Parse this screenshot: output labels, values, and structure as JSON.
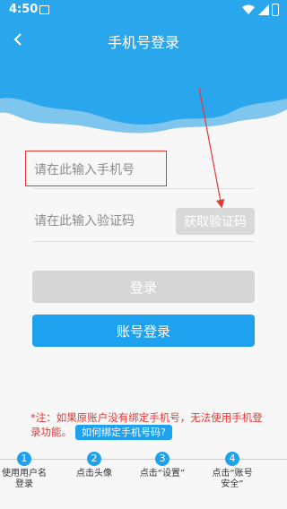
{
  "status_bar": {
    "time": "4:50"
  },
  "toolbar": {
    "title": "手机号登录",
    "back_icon": "back-arrow-icon"
  },
  "form": {
    "phone_placeholder": "请在此输入手机号",
    "code_placeholder": "请在此输入验证码",
    "get_code_label": "获取验证码",
    "login_label": "登录",
    "account_login_label": "账号登录"
  },
  "note": {
    "text": "*注：如果原账户没有绑定手机号，无法使用手机登录功能。",
    "link_label": "如何绑定手机号码?"
  },
  "steps": [
    {
      "num": "1",
      "label": "使用用户名登录"
    },
    {
      "num": "2",
      "label": "点击头像"
    },
    {
      "num": "3",
      "label": "点击“设置”"
    },
    {
      "num": "4",
      "label": "点击“账号安全”"
    }
  ],
  "colors": {
    "brand": "#2aa6ec",
    "button_blue": "#1ea1ef",
    "annotation_red": "#e53935",
    "disabled": "#d6d6d6"
  }
}
